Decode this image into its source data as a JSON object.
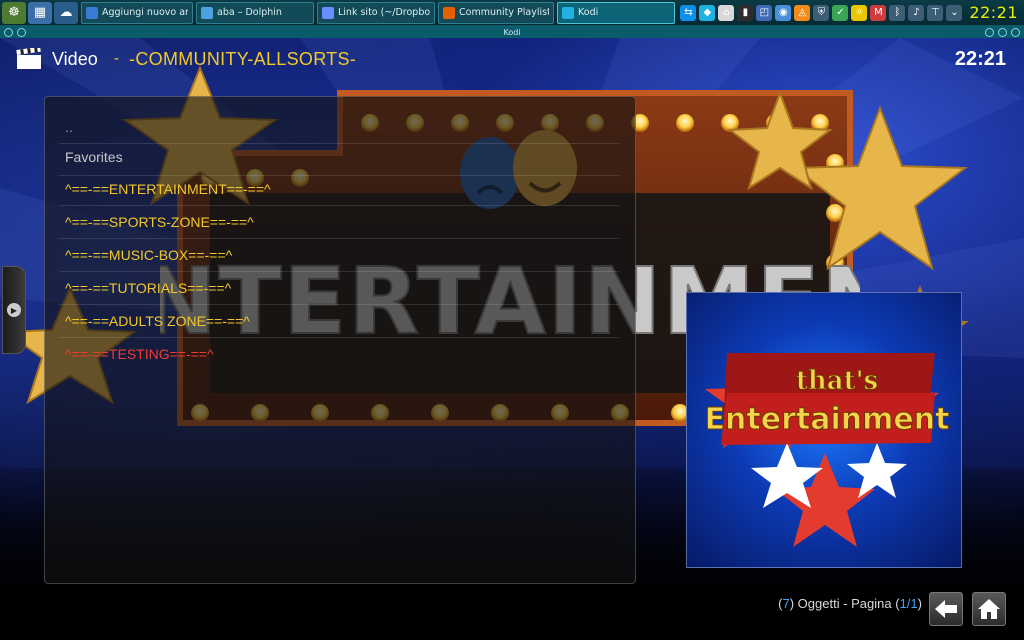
{
  "taskbar": {
    "launchers": [
      {
        "icon": "system-menu-icon",
        "glyph": "☸"
      },
      {
        "icon": "desktop-icon",
        "glyph": "▦"
      },
      {
        "icon": "cloud-icon",
        "glyph": "☁"
      }
    ],
    "tasks": [
      {
        "label": "Aggiungi nuovo articol",
        "icon": "browser-icon",
        "color": "#3a7bd5",
        "active": false
      },
      {
        "label": "aba – Dolphin",
        "icon": "folder-icon",
        "color": "#4aa3df",
        "active": false
      },
      {
        "label": "Link sito (~/Dropbox/SE",
        "icon": "text-editor-icon",
        "color": "#6b8cff",
        "active": false
      },
      {
        "label": "Community Playlists per",
        "icon": "firefox-icon",
        "color": "#e66000",
        "active": false
      },
      {
        "label": "Kodi",
        "icon": "kodi-icon",
        "color": "#1fb2e0",
        "active": true
      }
    ],
    "tray_icons": [
      {
        "name": "teamviewer-icon",
        "glyph": "⇆",
        "color": "#0e8ee9"
      },
      {
        "name": "kodi-tray-icon",
        "glyph": "◆",
        "color": "#1fb2e0"
      },
      {
        "name": "shopping-icon",
        "glyph": "⌂",
        "color": "#d9d9d9"
      },
      {
        "name": "terminal-icon",
        "glyph": "▮",
        "color": "#2d2d2d"
      },
      {
        "name": "screenshot-icon",
        "glyph": "◰",
        "color": "#3f6cb5"
      },
      {
        "name": "network-manager-icon",
        "glyph": "◉",
        "color": "#4a8fd8"
      },
      {
        "name": "vlc-icon",
        "glyph": "◬",
        "color": "#f08b1c"
      },
      {
        "name": "shield-icon",
        "glyph": "⛨",
        "color": "#3d5f75"
      },
      {
        "name": "updates-icon",
        "glyph": "✓",
        "color": "#3aa655"
      },
      {
        "name": "weather-icon",
        "glyph": "☼",
        "color": "#e9c600"
      },
      {
        "name": "mail-icon",
        "glyph": "M",
        "color": "#d23b3b"
      },
      {
        "name": "bluetooth-icon",
        "glyph": "ᛒ",
        "color": "#3d5f75"
      },
      {
        "name": "volume-icon",
        "glyph": "♪",
        "color": "#3d5f75"
      },
      {
        "name": "network-icon",
        "glyph": "⊤",
        "color": "#3d5f75"
      },
      {
        "name": "expand-tray-icon",
        "glyph": "⌄",
        "color": "#3d5f75"
      }
    ],
    "clock": "22:21"
  },
  "window": {
    "title": "Kodi"
  },
  "kodi": {
    "header": {
      "section": "Video",
      "separator": "-",
      "path": "-COMMUNITY-ALLSORTS-",
      "time": "22:21"
    },
    "list": {
      "parent": "..",
      "favorites": "Favorites",
      "items": [
        {
          "label": "^==-==ENTERTAINMENT==-==^",
          "color": "#f3c82a"
        },
        {
          "label": "^==-==SPORTS-ZONE==-==^",
          "color": "#f3c82a"
        },
        {
          "label": "^==-==MUSIC-BOX==-==^",
          "color": "#f3c82a"
        },
        {
          "label": "^==-==TUTORIALS==-==^",
          "color": "#f3c82a"
        },
        {
          "label": "^==-==ADULTS ZONE==-==^",
          "color": "#f3c82a"
        },
        {
          "label": "^==-==TESTING==-==^",
          "color": "#ef3b2f"
        }
      ]
    },
    "background_sign": "ENTERTAINMENT",
    "thumbnail": {
      "line1": "that's",
      "line2": "Entertainment"
    },
    "footer": {
      "count": "7",
      "objects_label": "Oggetti - Pagina",
      "page": "1/1"
    },
    "colors": {
      "accent": "#f3c82a",
      "highlight": "#ef3b2f",
      "info": "#3ba6ff"
    }
  }
}
